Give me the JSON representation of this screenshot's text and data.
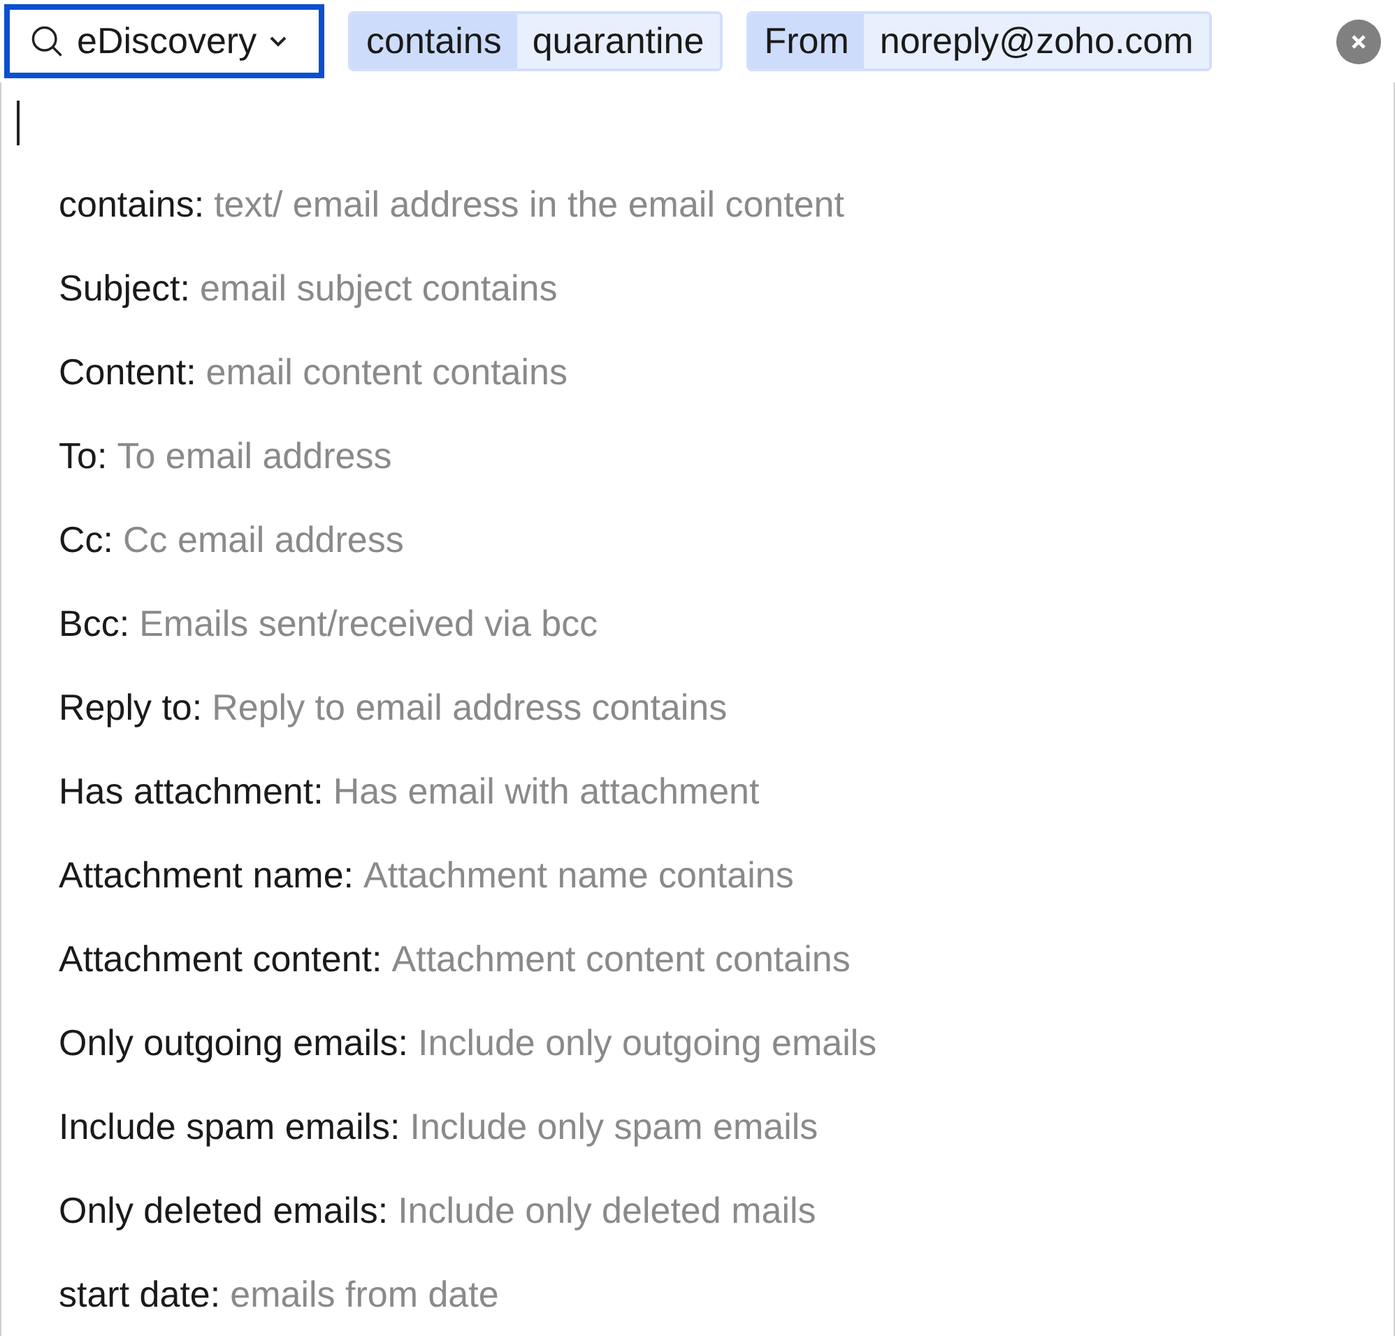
{
  "search_scope": {
    "label": "eDiscovery"
  },
  "filters": [
    {
      "field": "contains",
      "value": "quarantine"
    },
    {
      "field": "From",
      "value": "noreply@zoho.com"
    }
  ],
  "suggestions": [
    {
      "key": "contains:",
      "hint": "text/ email address in the email content"
    },
    {
      "key": "Subject:",
      "hint": "email subject contains"
    },
    {
      "key": "Content:",
      "hint": "email content contains"
    },
    {
      "key": "To:",
      "hint": "To email address"
    },
    {
      "key": "Cc:",
      "hint": "Cc email address"
    },
    {
      "key": "Bcc:",
      "hint": "Emails sent/received via bcc"
    },
    {
      "key": "Reply to:",
      "hint": "Reply to email address contains"
    },
    {
      "key": "Has attachment:",
      "hint": "Has email with attachment"
    },
    {
      "key": "Attachment name:",
      "hint": "Attachment name contains"
    },
    {
      "key": "Attachment content:",
      "hint": "Attachment content contains"
    },
    {
      "key": "Only outgoing emails:",
      "hint": "Include only outgoing emails"
    },
    {
      "key": "Include spam emails:",
      "hint": "Include only spam emails"
    },
    {
      "key": "Only deleted emails:",
      "hint": "Include only deleted mails"
    },
    {
      "key": "start date:",
      "hint": "emails from date"
    }
  ]
}
